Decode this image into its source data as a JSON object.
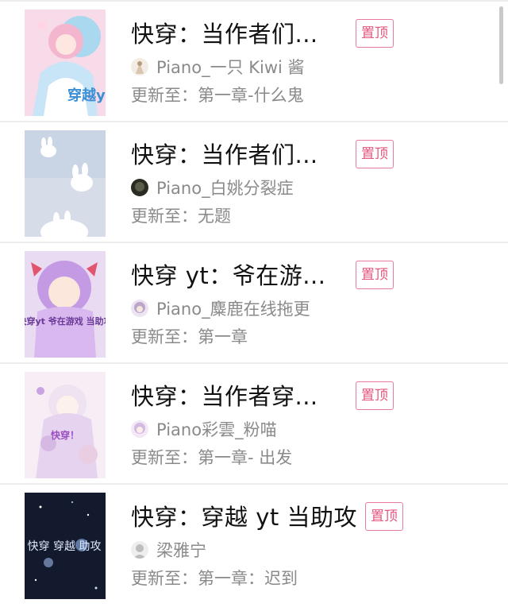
{
  "books": [
    {
      "title": "快穿：当作者们...",
      "pin_label": "置顶",
      "author": "Piano_一只 Kiwi 酱",
      "update_prefix": "更新至：",
      "update_chapter": "第一章-什么鬼",
      "cover_text": "穿越yt",
      "cover_colors": [
        "#f6c7dd",
        "#a9d8ef",
        "#ffffff"
      ],
      "avatar_color": "#d9c6b0"
    },
    {
      "title": "快穿：当作者们...",
      "pin_label": "置顶",
      "author": "Piano_白姚分裂症",
      "update_prefix": "更新至：",
      "update_chapter": "无题",
      "cover_text": "",
      "cover_colors": [
        "#bcc9dd",
        "#d9dfe9",
        "#ffffff"
      ],
      "avatar_color": "#3a3a2a"
    },
    {
      "title": "快穿 yt：爷在游...",
      "pin_label": "置顶",
      "author": "Piano_麋鹿在线拖更",
      "update_prefix": "更新至：",
      "update_chapter": "第一章",
      "cover_text": "快穿yt 爷在游戏 当助攻",
      "cover_colors": [
        "#c7a3e6",
        "#f2c6d0",
        "#8f5cc4"
      ],
      "avatar_color": "#b9a6c8"
    },
    {
      "title": "快穿：当作者穿...",
      "pin_label": "置顶",
      "author": "Piano彩雲_粉喵",
      "update_prefix": "更新至：",
      "update_chapter": "第一章- 出发",
      "cover_text": "快穿！",
      "cover_colors": [
        "#f6eaf3",
        "#e4d2ee",
        "#b58ad6"
      ],
      "avatar_color": "#d6b9e3"
    },
    {
      "title": "快穿：穿越 yt 当助攻",
      "pin_label": "置顶",
      "author": "梁雅宁",
      "update_prefix": "更新至：",
      "update_chapter": "第一章：迟到",
      "cover_text": "快穿 穿越 助攻",
      "cover_colors": [
        "#141a2e",
        "#2b3a66",
        "#7fa3d9"
      ],
      "avatar_color": "#d0d0d0"
    }
  ]
}
